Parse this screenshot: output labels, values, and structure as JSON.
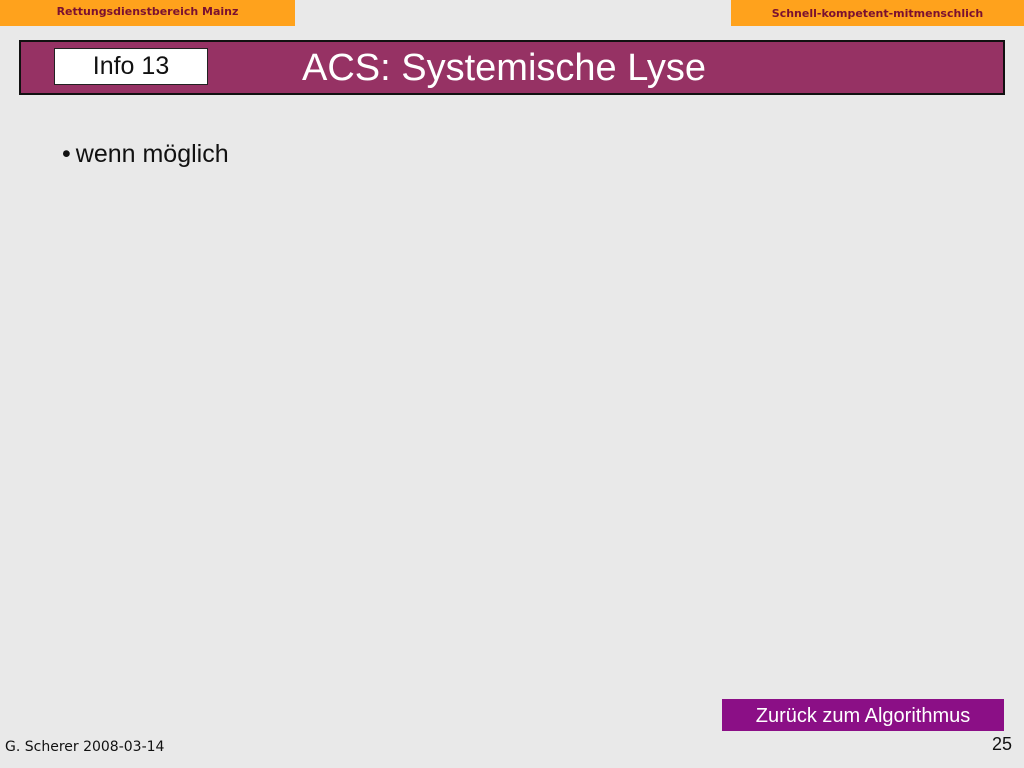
{
  "header": {
    "organization": "Rettungsdienstbereich Mainz",
    "slogan": "Schnell-kompetent-mitmenschlich"
  },
  "title_bar": {
    "info_label": "Info 13",
    "title": "ACS: Systemische Lyse"
  },
  "content": {
    "bullets": [
      {
        "marker": "•",
        "text": "wenn möglich"
      }
    ]
  },
  "navigation": {
    "back_button_label": "Zurück zum Algorithmus"
  },
  "footer": {
    "author_date": "G. Scherer 2008-03-14",
    "page_number": "25"
  },
  "colors": {
    "background": "#e9e9e9",
    "header_badge": "#ffa21c",
    "header_text": "#7a1030",
    "title_bar": "#963264",
    "button": "#8b0f86"
  }
}
